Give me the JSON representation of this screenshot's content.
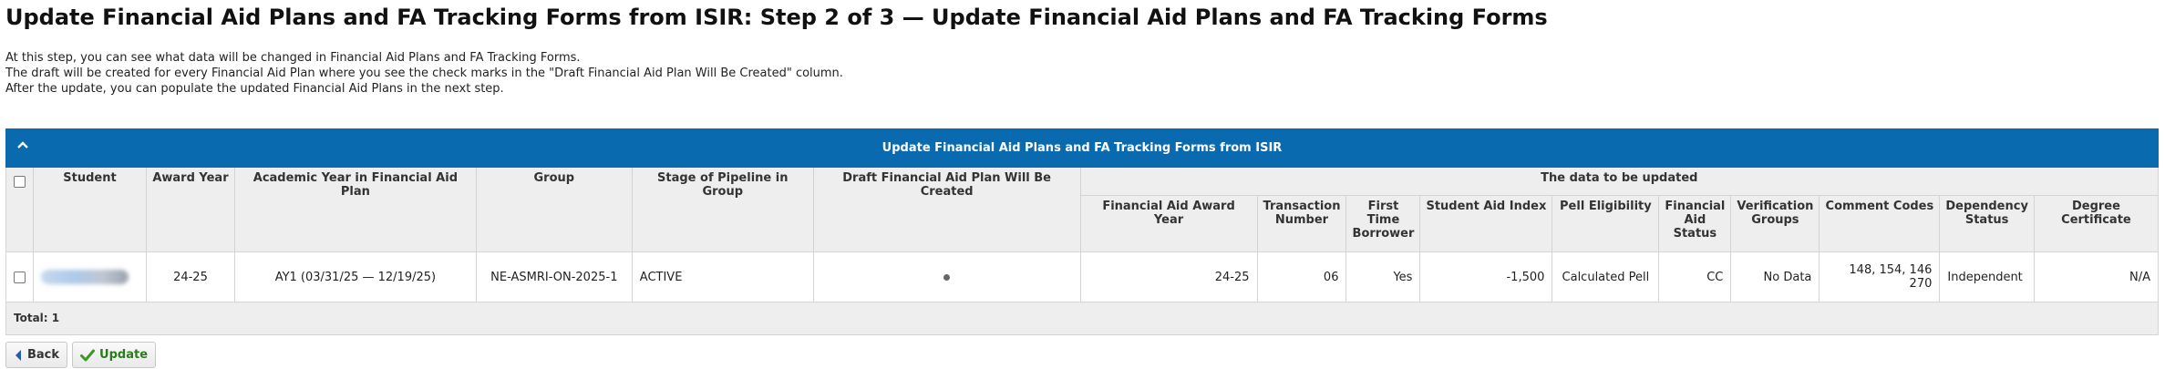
{
  "page_title": "Update Financial Aid Plans and FA Tracking Forms from ISIR: Step 2 of 3 — Update Financial Aid Plans and FA Tracking Forms",
  "intro": [
    "At this step, you can see what data will be changed in Financial Aid Plans and FA Tracking Forms.",
    "The draft will be created for every Financial Aid Plan where you see the check marks in the \"Draft Financial Aid Plan Will Be Created\" column.",
    "After the update, you can populate the updated Financial Aid Plans in the next step."
  ],
  "grid": {
    "title": "Update Financial Aid Plans and FA Tracking Forms from ISIR",
    "group_header": "The data to be updated",
    "columns": {
      "student": "Student",
      "award_year": "Award Year",
      "academic_year": "Academic Year in Financial Aid Plan",
      "group": "Group",
      "stage": "Stage of Pipeline in Group",
      "draft": "Draft Financial Aid Plan Will Be Created",
      "fa_award_year": "Financial Aid Award Year",
      "transaction_number": "Transaction Number",
      "first_time_borrower": "First Time Borrower",
      "student_aid_index": "Student Aid Index",
      "pell_eligibility": "Pell Eligibility",
      "fa_status": "Financial Aid Status",
      "verification_groups": "Verification Groups",
      "comment_codes": "Comment Codes",
      "dependency_status": "Dependency Status",
      "degree_certificate": "Degree Certificate"
    },
    "rows": [
      {
        "award_year": "24-25",
        "academic_year": "AY1 (03/31/25 — 12/19/25)",
        "group": "NE-ASMRI-ON-2025-1",
        "stage": "ACTIVE",
        "fa_award_year": "24-25",
        "transaction_number": "06",
        "first_time_borrower": "Yes",
        "student_aid_index": "-1,500",
        "pell_eligibility": "Calculated Pell",
        "fa_status": "CC",
        "verification_groups": "No Data",
        "comment_codes": "148, 154, 146 270",
        "dependency_status": "Independent",
        "degree_certificate": "N/A"
      }
    ],
    "total": "Total: 1"
  },
  "buttons": {
    "back": "Back",
    "update": "Update"
  }
}
